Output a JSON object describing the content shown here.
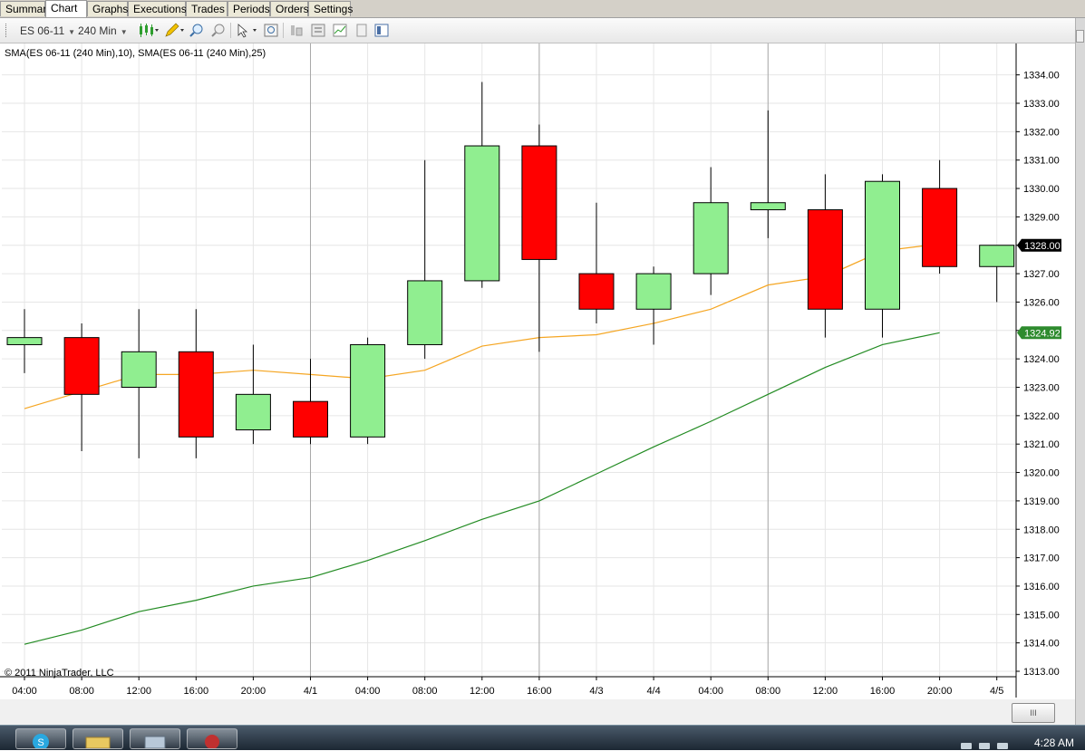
{
  "tabs": [
    "Summary",
    "Chart",
    "Graphs",
    "Executions",
    "Trades",
    "Periods",
    "Orders",
    "Settings"
  ],
  "active_tab": "Chart",
  "toolbar": {
    "instrument": "ES 06-11",
    "interval": "240 Min"
  },
  "indicator_label": "SMA(ES 06-11 (240 Min),10), SMA(ES 06-11 (240 Min),25)",
  "copyright": "© 2011 NinjaTrader, LLC",
  "scrollbar_grip": "III",
  "taskbar": {
    "clock": "4:28 AM"
  },
  "colors": {
    "up_candle": "#90ee90",
    "down_candle": "#ff0000",
    "sma10": "#f5a623",
    "sma25": "#228b22",
    "last_price_tag": "#000000",
    "sma_tag": "#2e8b2e"
  },
  "chart_data": {
    "type": "candlestick",
    "title": "",
    "ylim": [
      1312.8,
      1334.8
    ],
    "y_ticks": [
      "1313.00",
      "1314.00",
      "1315.00",
      "1316.00",
      "1317.00",
      "1318.00",
      "1319.00",
      "1320.00",
      "1321.00",
      "1322.00",
      "1323.00",
      "1324.00",
      "1325.00",
      "1326.00",
      "1327.00",
      "1328.00",
      "1329.00",
      "1330.00",
      "1331.00",
      "1332.00",
      "1333.00",
      "1334.00"
    ],
    "x_labels": [
      "04:00",
      "08:00",
      "12:00",
      "16:00",
      "20:00",
      "4/1",
      "04:00",
      "08:00",
      "12:00",
      "16:00",
      "4/3",
      "4/4",
      "04:00",
      "08:00",
      "12:00",
      "16:00",
      "20:00",
      "4/5"
    ],
    "day_separators": [
      "4/1",
      "16:00",
      "08:00"
    ],
    "candles": [
      {
        "open": 1324.5,
        "high": 1325.75,
        "low": 1323.5,
        "close": 1324.75
      },
      {
        "open": 1324.75,
        "high": 1325.25,
        "low": 1320.75,
        "close": 1322.75
      },
      {
        "open": 1323.0,
        "high": 1325.75,
        "low": 1320.5,
        "close": 1324.25
      },
      {
        "open": 1324.25,
        "high": 1325.75,
        "low": 1320.5,
        "close": 1321.25
      },
      {
        "open": 1321.5,
        "high": 1324.5,
        "low": 1321.0,
        "close": 1322.75
      },
      {
        "open": 1322.5,
        "high": 1324.0,
        "low": 1321.0,
        "close": 1321.25
      },
      {
        "open": 1321.25,
        "high": 1324.75,
        "low": 1321.0,
        "close": 1324.5
      },
      {
        "open": 1324.5,
        "high": 1331.0,
        "low": 1324.0,
        "close": 1326.75
      },
      {
        "open": 1326.75,
        "high": 1333.75,
        "low": 1326.5,
        "close": 1331.5
      },
      {
        "open": 1331.5,
        "high": 1332.25,
        "low": 1324.25,
        "close": 1327.5
      },
      {
        "open": 1327.0,
        "high": 1329.5,
        "low": 1325.25,
        "close": 1325.75
      },
      {
        "open": 1325.75,
        "high": 1327.25,
        "low": 1324.5,
        "close": 1327.0
      },
      {
        "open": 1327.0,
        "high": 1330.75,
        "low": 1326.25,
        "close": 1329.5
      },
      {
        "open": 1329.25,
        "high": 1332.75,
        "low": 1328.25,
        "close": 1329.5
      },
      {
        "open": 1329.25,
        "high": 1330.5,
        "low": 1324.75,
        "close": 1325.75
      },
      {
        "open": 1325.75,
        "high": 1330.5,
        "low": 1324.75,
        "close": 1330.25
      },
      {
        "open": 1330.0,
        "high": 1331.0,
        "low": 1327.0,
        "close": 1327.25
      },
      {
        "open": 1327.25,
        "high": 1328.0,
        "low": 1326.0,
        "close": 1328.0
      }
    ],
    "series": [
      {
        "values": [
          1322.25,
          1322.85,
          1323.45,
          1323.45,
          1323.6,
          1323.45,
          1323.3,
          1323.6,
          1324.45,
          1324.75,
          1324.85,
          1325.25,
          1325.75,
          1326.6,
          1326.9,
          1327.8,
          1328.05
        ]
      },
      {
        "values": [
          1313.95,
          1314.45,
          1315.1,
          1315.5,
          1316.0,
          1316.3,
          1316.9,
          1317.6,
          1318.35,
          1319.0,
          1319.95,
          1320.9,
          1321.8,
          1322.75,
          1323.7,
          1324.5,
          1324.92
        ]
      }
    ],
    "last_price": "1328.00",
    "sma25_last": "1324.92"
  }
}
